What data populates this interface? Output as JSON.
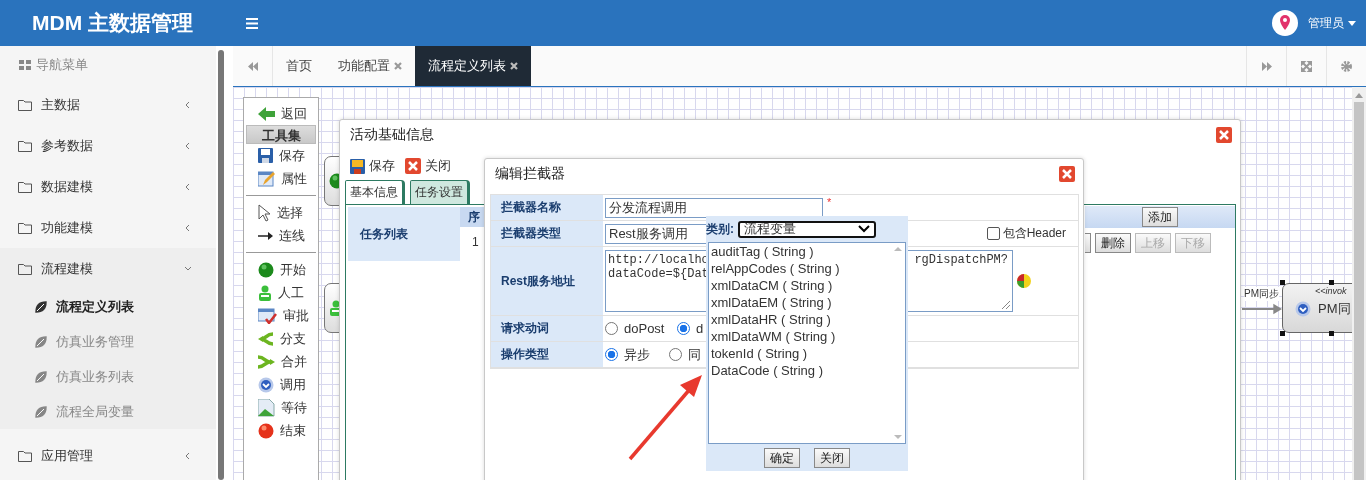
{
  "header": {
    "title": "MDM 主数据管理",
    "user": "管理员"
  },
  "sidebar": {
    "title": "导航菜单",
    "items": [
      {
        "label": "主数据",
        "expanded": false
      },
      {
        "label": "参考数据",
        "expanded": false
      },
      {
        "label": "数据建模",
        "expanded": false
      },
      {
        "label": "功能建模",
        "expanded": false
      },
      {
        "label": "流程建模",
        "expanded": true,
        "children": [
          {
            "label": "流程定义列表",
            "selected": true
          },
          {
            "label": "仿真业务管理",
            "selected": false
          },
          {
            "label": "仿真业务列表",
            "selected": false
          },
          {
            "label": "流程全局变量",
            "selected": false
          }
        ]
      },
      {
        "label": "应用管理",
        "expanded": false
      }
    ]
  },
  "tabs": [
    {
      "label": "首页",
      "closable": false,
      "selected": false
    },
    {
      "label": "功能配置",
      "closable": true,
      "selected": false
    },
    {
      "label": "流程定义列表",
      "closable": true,
      "selected": true
    }
  ],
  "toolbox": {
    "back": "返回",
    "title": "工具集",
    "groups": [
      [
        {
          "kind": "save",
          "label": "保存"
        },
        {
          "kind": "props",
          "label": "属性"
        }
      ],
      [
        {
          "kind": "select",
          "label": "选择"
        },
        {
          "kind": "connect",
          "label": "连线"
        }
      ],
      [
        {
          "kind": "start",
          "label": "开始"
        },
        {
          "kind": "manual",
          "label": "人工"
        },
        {
          "kind": "approve",
          "label": "审批"
        },
        {
          "kind": "branch",
          "label": "分支"
        },
        {
          "kind": "merge",
          "label": "合并"
        },
        {
          "kind": "invoke",
          "label": "调用"
        },
        {
          "kind": "wait",
          "label": "等待"
        },
        {
          "kind": "end",
          "label": "结束"
        }
      ]
    ]
  },
  "canvas": {
    "nodes": [
      {
        "kind": "start"
      },
      {
        "kind": "manual"
      },
      {
        "kind": "invoke",
        "stereotype": "<<invok",
        "label": "PM同"
      }
    ],
    "edge_label": "PM同步"
  },
  "activity_dialog": {
    "title": "活动基础信息",
    "toolbar": [
      {
        "kind": "save",
        "label": "保存"
      },
      {
        "kind": "close",
        "label": "关闭"
      }
    ],
    "tabs": [
      {
        "label": "基本信息",
        "selected": false
      },
      {
        "label": "任务设置",
        "selected": true
      }
    ],
    "task_list": {
      "label": "任务列表",
      "column_1": "序",
      "rows": [
        "1"
      ]
    },
    "add_button": "添加",
    "buttons": [
      {
        "label": "删除",
        "disabled": false
      },
      {
        "label": "上移",
        "disabled": true
      },
      {
        "label": "下移",
        "disabled": true
      }
    ]
  },
  "interceptor_dialog": {
    "title": "编辑拦截器",
    "fields": [
      {
        "kind": "text",
        "label": "拦截器名称",
        "value": "分发流程调用",
        "required_mark": "*"
      },
      {
        "kind": "select",
        "label": "拦截器类型",
        "value": "Rest服务调用",
        "option": {
          "label": "包含Header",
          "checked": false
        }
      },
      {
        "kind": "textarea",
        "label": "Rest服务地址",
        "lines_left": [
          "http://localho",
          "dataCode=${Dat"
        ],
        "lines_right": [
          "rgDispatchPM?"
        ]
      },
      {
        "kind": "radio",
        "label": "请求动词",
        "options": [
          {
            "label": "doPost",
            "selected": false
          },
          {
            "label": "d",
            "selected": true
          }
        ]
      },
      {
        "kind": "radio",
        "label": "操作类型",
        "options": [
          {
            "label": "异步",
            "selected": true
          },
          {
            "label": "同",
            "selected": false
          }
        ]
      }
    ]
  },
  "variable_picker": {
    "category_label": "类别:",
    "category": "流程变量",
    "items": [
      {
        "label": "auditTag ( String )",
        "selected": false
      },
      {
        "label": "relAppCodes ( String )",
        "selected": false
      },
      {
        "label": "xmlDataCM ( String )",
        "selected": false
      },
      {
        "label": "xmlDataEM ( String )",
        "selected": false
      },
      {
        "label": "xmlDataHR ( String )",
        "selected": false
      },
      {
        "label": "xmlDataWM ( String )",
        "selected": false
      },
      {
        "label": "tokenId ( String )",
        "selected": false
      },
      {
        "label": "DataCode ( String )",
        "selected": false
      }
    ],
    "buttons": [
      "确定",
      "关闭"
    ]
  }
}
